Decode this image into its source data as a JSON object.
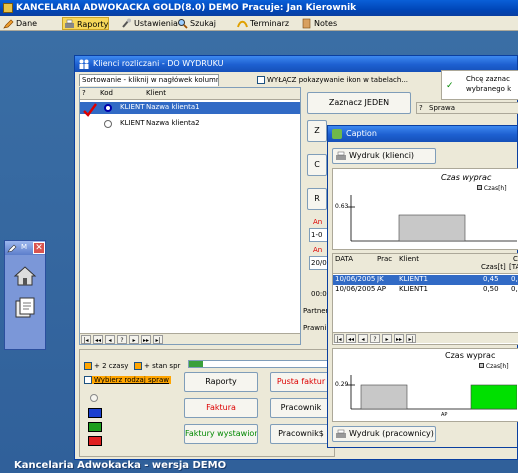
{
  "app": {
    "title": "KANCELARIA ADWOKACKA GOLD(8.0) DEMO   Pracuje: Jan Kierownik"
  },
  "menu": {
    "items": [
      {
        "label": "Dane"
      },
      {
        "label": "Raporty"
      },
      {
        "label": "Ustawienia"
      },
      {
        "label": "Szukaj"
      },
      {
        "label": "Terminarz"
      },
      {
        "label": "Notes"
      }
    ]
  },
  "mini_panel": {
    "label": "M"
  },
  "footer": {
    "text": "Kancelaria Adwokacka - wersja DEMO"
  },
  "klienci_window": {
    "title": "Klienci rozliczani - DO WYDRUKU",
    "tab": "Sortowanie - kliknij w nagłówek kolumny",
    "disable_icons_label": "WYŁĄCZ pokazywanie ikon w tabelach...",
    "columns": [
      "?",
      "Kod",
      "Klient"
    ],
    "rows": [
      {
        "kod": "KLIENT",
        "klient": "Nazwa klienta1"
      },
      {
        "kod": "KLIENT",
        "klient": "Nazwa klienta2"
      }
    ],
    "zaznacz_jeden": "Zaznacz JEDEN",
    "partial_buttons": [
      "Z",
      "C",
      "R"
    ],
    "field_labels": [
      "An",
      "An"
    ],
    "field_values": [
      "1-0",
      "20/0"
    ],
    "side_text": [
      "00:0",
      "Partner",
      "Prawnik"
    ],
    "info_text_line1": "Chcę zaznac",
    "info_text_line2": "wybranego k",
    "sprawa_label": "Sprawa",
    "sprawa_q": "?"
  },
  "bottom_panel": {
    "option1": "+ 2 czasy",
    "option2": "+ stan spr",
    "wybierz": "Wybierz rodzaj spraw",
    "buttons": {
      "raporty": "Raporty",
      "pusta_faktura": "Pusta faktur",
      "faktura": "Faktura",
      "pracownik": "Pracownik",
      "faktury_wystawione": "Faktury wystawione",
      "pracownik_s": "Pracownik$"
    }
  },
  "caption_window": {
    "title": "Caption",
    "wydruk_klienci": "Wydruk (klienci)",
    "wydruk_pracownicy": "Wydruk (pracownicy)",
    "chart1_title": "Czas wyprac",
    "chart1_legend": "Czas[h]",
    "chart1_tick": "0.63",
    "chart2_title": "Czas wyprac",
    "chart2_legend": "Czas[h]",
    "chart2_tick": "0.29",
    "chart2_xlabel": "AP",
    "table_headers": [
      "DATA",
      "Prac",
      "Klient",
      "Czas[t]",
      "[TA]"
    ],
    "table_header_top": "Cz",
    "table_rows": [
      {
        "data": "10/06/2005",
        "prac": "JK",
        "klient": "KLIENT1",
        "czas": "0,45",
        "ta": "0,"
      },
      {
        "data": "10/06/2005",
        "prac": "AP",
        "klient": "KLIENT1",
        "czas": "0,50",
        "ta": "0,"
      }
    ]
  },
  "colors": {
    "desktop": "#3a6ea5",
    "titlebar": "#0a5fd8",
    "selection": "#316ac5",
    "bar_gray": "#c8c8c8",
    "bar_green": "#00e000"
  },
  "chart_data": [
    {
      "type": "bar",
      "title": "Czas wyprac",
      "legend": [
        "Czas[h]"
      ],
      "y_ticks": [
        "0.63"
      ]
    },
    {
      "type": "bar",
      "title": "Czas wyprac",
      "legend": [
        "Czas[h]"
      ],
      "y_ticks": [
        "0.29"
      ],
      "x_tick_labels": [
        "AP"
      ]
    }
  ]
}
